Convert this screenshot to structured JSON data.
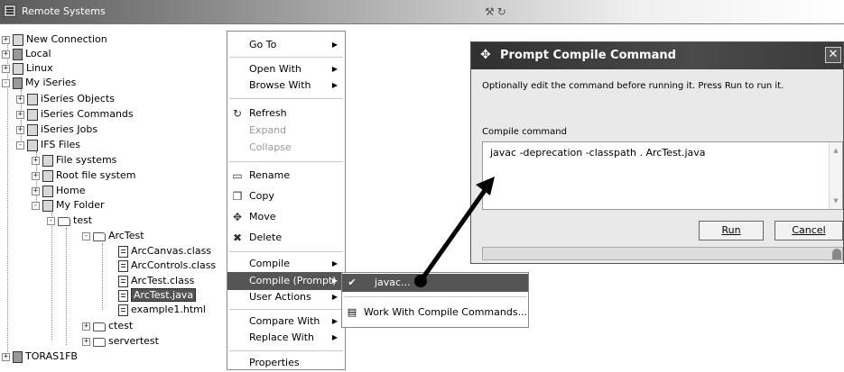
{
  "view": {
    "title": "Remote Systems"
  },
  "tree": [
    {
      "label": "New Connection",
      "expander": "+"
    },
    {
      "label": "Local",
      "expander": "+"
    },
    {
      "label": "Linux",
      "expander": "+"
    },
    {
      "label": "My iSeries",
      "expander": "-"
    },
    {
      "label": "iSeries Objects",
      "expander": "+"
    },
    {
      "label": "iSeries Commands",
      "expander": "+"
    },
    {
      "label": "iSeries Jobs",
      "expander": "+"
    },
    {
      "label": "IFS Files",
      "expander": "-"
    },
    {
      "label": "File systems",
      "expander": "+"
    },
    {
      "label": "Root file system",
      "expander": "+"
    },
    {
      "label": "Home",
      "expander": "+"
    },
    {
      "label": "My Folder",
      "expander": "-"
    },
    {
      "label": "test",
      "expander": "-"
    },
    {
      "label": "ArcTest",
      "expander": "-"
    },
    {
      "label": "ArcCanvas.class",
      "expander": ""
    },
    {
      "label": "ArcControls.class",
      "expander": ""
    },
    {
      "label": "ArcTest.class",
      "expander": ""
    },
    {
      "label": "ArcTest.java",
      "expander": ""
    },
    {
      "label": "example1.html",
      "expander": ""
    },
    {
      "label": "ctest",
      "expander": "+"
    },
    {
      "label": "servertest",
      "expander": "+"
    },
    {
      "label": "TORAS1FB",
      "expander": "+"
    }
  ],
  "menu": {
    "items": [
      {
        "label": "Go To",
        "arrow": "▶"
      },
      {
        "label": "Open With",
        "arrow": "▶"
      },
      {
        "label": "Browse With",
        "arrow": "▶"
      },
      {
        "label": "Refresh",
        "arrow": ""
      },
      {
        "label": "Expand",
        "arrow": ""
      },
      {
        "label": "Collapse",
        "arrow": ""
      },
      {
        "label": "Rename",
        "arrow": ""
      },
      {
        "label": "Copy",
        "arrow": ""
      },
      {
        "label": "Move",
        "arrow": ""
      },
      {
        "label": "Delete",
        "arrow": ""
      },
      {
        "label": "Compile",
        "arrow": "▶"
      },
      {
        "label": "Compile (Prompt)",
        "arrow": "▶"
      },
      {
        "label": "User Actions",
        "arrow": "▶"
      },
      {
        "label": "Compare With",
        "arrow": "▶"
      },
      {
        "label": "Replace With",
        "arrow": "▶"
      },
      {
        "label": "Properties",
        "arrow": ""
      }
    ]
  },
  "submenu": {
    "items": [
      {
        "label": "javac..."
      },
      {
        "label": "Work With Compile Commands..."
      }
    ]
  },
  "dialog": {
    "title": "Prompt Compile Command",
    "close": "✕",
    "message": "Optionally edit the command before running it. Press Run to run it.",
    "field_label": "Compile command",
    "field_value": "javac  -deprecation -classpath . ArcTest.java",
    "run_label": "Run",
    "cancel_label": "Cancel"
  }
}
